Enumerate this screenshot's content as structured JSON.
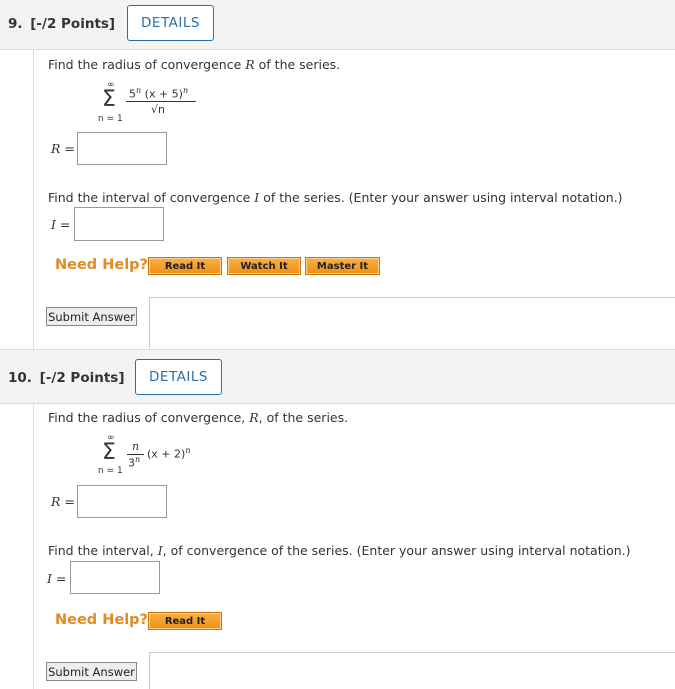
{
  "q9": {
    "number": "9.",
    "points": "[-/2 Points]",
    "details_label": "DETAILS",
    "prompt_radius_pre": "Find the radius of convergence ",
    "prompt_radius_var": "R",
    "prompt_radius_post": " of the series.",
    "series": {
      "sum_top": "∞",
      "sum_bottom": "n = 1",
      "numerator": "5",
      "numerator_exp": "n",
      "numerator_rest": "(x + 5)",
      "numerator_rest_exp": "n",
      "denominator": "√n"
    },
    "r_label": "R =",
    "prompt_interval_pre": "Find the interval of convergence ",
    "prompt_interval_var": "I",
    "prompt_interval_post": " of the series. (Enter your answer using interval notation.)",
    "i_label": "I =",
    "need_help": "Need Help?",
    "help_buttons": [
      "Read It",
      "Watch It",
      "Master It"
    ],
    "submit_label": "Submit Answer"
  },
  "q10": {
    "number": "10.",
    "points": "[-/2 Points]",
    "details_label": "DETAILS",
    "prompt_radius_pre": "Find the radius of convergence, ",
    "prompt_radius_var": "R",
    "prompt_radius_post": ", of the series.",
    "series": {
      "sum_top": "∞",
      "sum_bottom": "n = 1",
      "numerator": "n",
      "denominator": "3",
      "denominator_exp": "n",
      "rest": "(x + 2)",
      "rest_exp": "n"
    },
    "r_label": "R =",
    "prompt_interval_pre": "Find the interval, ",
    "prompt_interval_var": "I",
    "prompt_interval_post": ", of convergence of the series. (Enter your answer using interval notation.)",
    "i_label": "I =",
    "need_help": "Need Help?",
    "help_buttons": [
      "Read It"
    ],
    "submit_label": "Submit Answer"
  }
}
